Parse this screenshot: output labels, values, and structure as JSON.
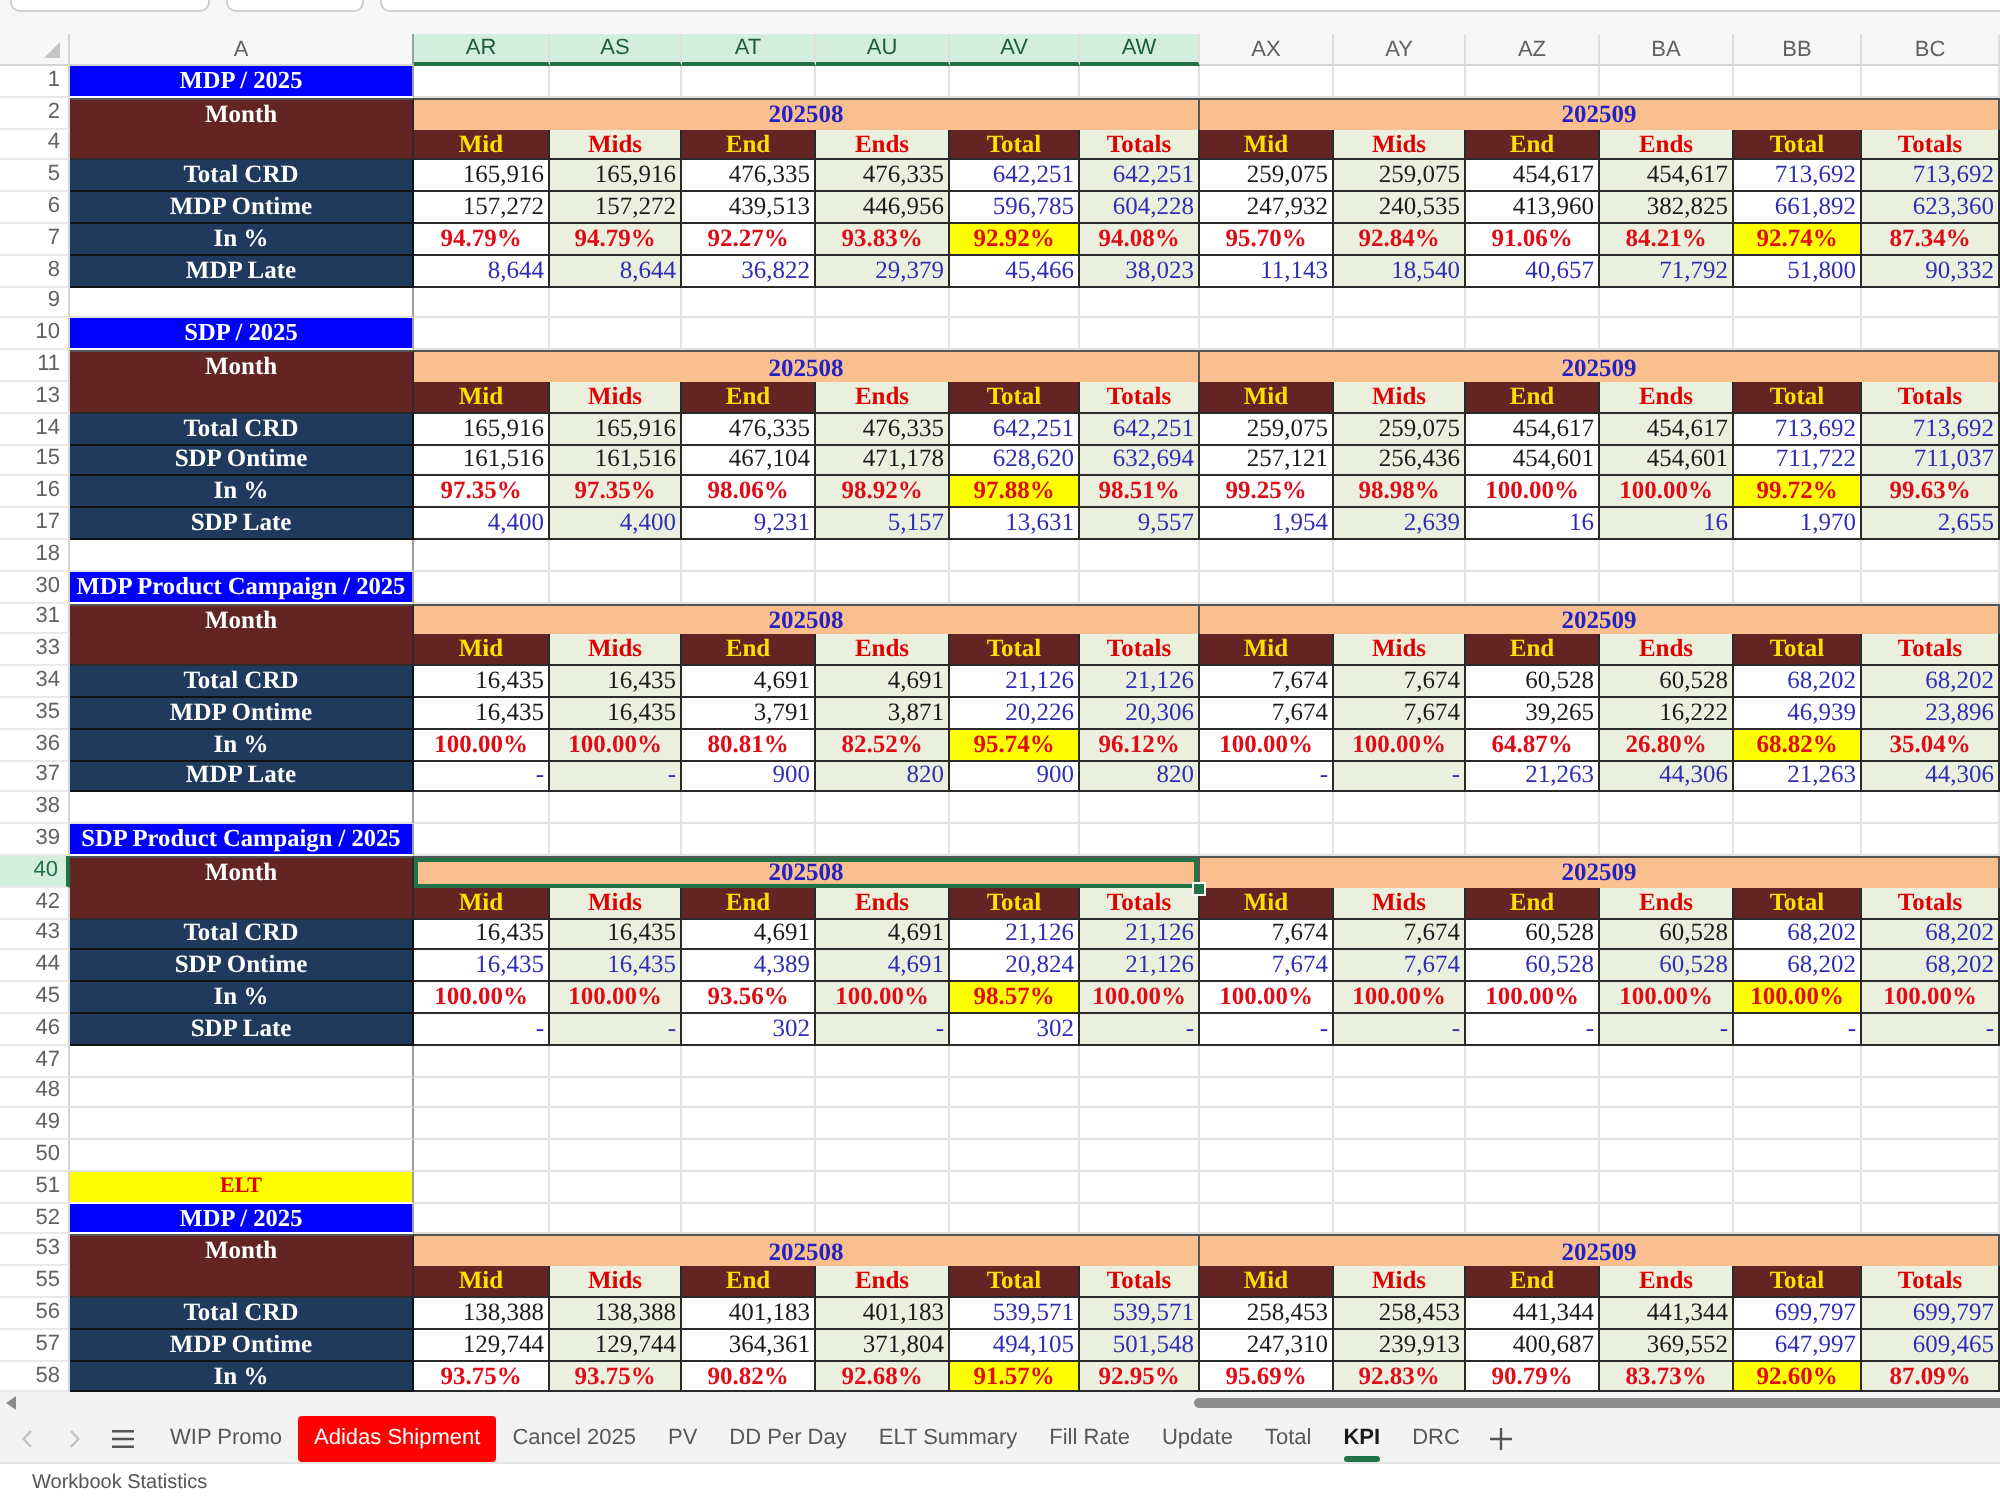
{
  "columns": [
    {
      "label": "A",
      "selected": false
    },
    {
      "label": "AR",
      "selected": true
    },
    {
      "label": "AS",
      "selected": true
    },
    {
      "label": "AT",
      "selected": true
    },
    {
      "label": "AU",
      "selected": true
    },
    {
      "label": "AV",
      "selected": true
    },
    {
      "label": "AW",
      "selected": true
    },
    {
      "label": "AX",
      "selected": false
    },
    {
      "label": "AY",
      "selected": false
    },
    {
      "label": "AZ",
      "selected": false
    },
    {
      "label": "BA",
      "selected": false
    },
    {
      "label": "BB",
      "selected": false
    },
    {
      "label": "BC",
      "selected": false
    }
  ],
  "rows": [
    {
      "number": "1",
      "selected": false,
      "kind": "title",
      "label": "MDP / 2025"
    },
    {
      "number": "2",
      "selected": false,
      "kind": "month",
      "label": "Month",
      "months": [
        "202508",
        "202509"
      ]
    },
    {
      "number": "4",
      "selected": false,
      "kind": "subheader",
      "cells": [
        "Mid",
        "Mids",
        "End",
        "Ends",
        "Total",
        "Totals",
        "Mid",
        "Mids",
        "End",
        "Ends",
        "Total",
        "Totals"
      ]
    },
    {
      "number": "5",
      "selected": false,
      "kind": "count",
      "label": "Total CRD",
      "cells": [
        "165,916",
        "165,916",
        "476,335",
        "476,335",
        "642,251",
        "642,251",
        "259,075",
        "259,075",
        "454,617",
        "454,617",
        "713,692",
        "713,692"
      ]
    },
    {
      "number": "6",
      "selected": false,
      "kind": "count",
      "label": "MDP Ontime",
      "cells": [
        "157,272",
        "157,272",
        "439,513",
        "446,956",
        "596,785",
        "604,228",
        "247,932",
        "240,535",
        "413,960",
        "382,825",
        "661,892",
        "623,360"
      ]
    },
    {
      "number": "7",
      "selected": false,
      "kind": "percent",
      "label": "In %",
      "cells": [
        "94.79%",
        "94.79%",
        "92.27%",
        "93.83%",
        "92.92%",
        "94.08%",
        "95.70%",
        "92.84%",
        "91.06%",
        "84.21%",
        "92.74%",
        "87.34%"
      ]
    },
    {
      "number": "8",
      "selected": false,
      "kind": "late",
      "label": "MDP Late",
      "cells": [
        "8,644",
        "8,644",
        "36,822",
        "29,379",
        "45,466",
        "38,023",
        "11,143",
        "18,540",
        "40,657",
        "71,792",
        "51,800",
        "90,332"
      ]
    },
    {
      "number": "9",
      "selected": false,
      "kind": "blank"
    },
    {
      "number": "10",
      "selected": false,
      "kind": "title",
      "label": "SDP / 2025"
    },
    {
      "number": "11",
      "selected": false,
      "kind": "month",
      "label": "Month",
      "months": [
        "202508",
        "202509"
      ]
    },
    {
      "number": "13",
      "selected": false,
      "kind": "subheader",
      "cells": [
        "Mid",
        "Mids",
        "End",
        "Ends",
        "Total",
        "Totals",
        "Mid",
        "Mids",
        "End",
        "Ends",
        "Total",
        "Totals"
      ]
    },
    {
      "number": "14",
      "selected": false,
      "kind": "count",
      "label": "Total CRD",
      "cells": [
        "165,916",
        "165,916",
        "476,335",
        "476,335",
        "642,251",
        "642,251",
        "259,075",
        "259,075",
        "454,617",
        "454,617",
        "713,692",
        "713,692"
      ]
    },
    {
      "number": "15",
      "selected": false,
      "kind": "count",
      "label": "SDP Ontime",
      "cells": [
        "161,516",
        "161,516",
        "467,104",
        "471,178",
        "628,620",
        "632,694",
        "257,121",
        "256,436",
        "454,601",
        "454,601",
        "711,722",
        "711,037"
      ]
    },
    {
      "number": "16",
      "selected": false,
      "kind": "percent",
      "label": "In %",
      "cells": [
        "97.35%",
        "97.35%",
        "98.06%",
        "98.92%",
        "97.88%",
        "98.51%",
        "99.25%",
        "98.98%",
        "100.00%",
        "100.00%",
        "99.72%",
        "99.63%"
      ]
    },
    {
      "number": "17",
      "selected": false,
      "kind": "late",
      "label": "SDP Late",
      "cells": [
        "4,400",
        "4,400",
        "9,231",
        "5,157",
        "13,631",
        "9,557",
        "1,954",
        "2,639",
        "16",
        "16",
        "1,970",
        "2,655"
      ]
    },
    {
      "number": "18",
      "selected": false,
      "kind": "blank"
    },
    {
      "number": "30",
      "selected": false,
      "kind": "title",
      "label": "MDP Product Campaign / 2025"
    },
    {
      "number": "31",
      "selected": false,
      "kind": "month",
      "label": "Month",
      "months": [
        "202508",
        "202509"
      ]
    },
    {
      "number": "33",
      "selected": false,
      "kind": "subheader",
      "cells": [
        "Mid",
        "Mids",
        "End",
        "Ends",
        "Total",
        "Totals",
        "Mid",
        "Mids",
        "End",
        "Ends",
        "Total",
        "Totals"
      ]
    },
    {
      "number": "34",
      "selected": false,
      "kind": "count",
      "label": "Total CRD",
      "cells": [
        "16,435",
        "16,435",
        "4,691",
        "4,691",
        "21,126",
        "21,126",
        "7,674",
        "7,674",
        "60,528",
        "60,528",
        "68,202",
        "68,202"
      ]
    },
    {
      "number": "35",
      "selected": false,
      "kind": "count",
      "label": "MDP Ontime",
      "cells": [
        "16,435",
        "16,435",
        "3,791",
        "3,871",
        "20,226",
        "20,306",
        "7,674",
        "7,674",
        "39,265",
        "16,222",
        "46,939",
        "23,896"
      ]
    },
    {
      "number": "36",
      "selected": false,
      "kind": "percent",
      "label": "In %",
      "cells": [
        "100.00%",
        "100.00%",
        "80.81%",
        "82.52%",
        "95.74%",
        "96.12%",
        "100.00%",
        "100.00%",
        "64.87%",
        "26.80%",
        "68.82%",
        "35.04%"
      ]
    },
    {
      "number": "37",
      "selected": false,
      "kind": "late",
      "label": "MDP Late",
      "cells": [
        "-",
        "-",
        "900",
        "820",
        "900",
        "820",
        "-",
        "-",
        "21,263",
        "44,306",
        "21,263",
        "44,306"
      ]
    },
    {
      "number": "38",
      "selected": false,
      "kind": "blank"
    },
    {
      "number": "39",
      "selected": false,
      "kind": "title",
      "label": "SDP Product Campaign / 2025"
    },
    {
      "number": "40",
      "selected": true,
      "kind": "month",
      "label": "Month",
      "months": [
        "202508",
        "202509"
      ]
    },
    {
      "number": "42",
      "selected": false,
      "kind": "subheader",
      "cells": [
        "Mid",
        "Mids",
        "End",
        "Ends",
        "Total",
        "Totals",
        "Mid",
        "Mids",
        "End",
        "Ends",
        "Total",
        "Totals"
      ]
    },
    {
      "number": "43",
      "selected": false,
      "kind": "count",
      "label": "Total CRD",
      "cells": [
        "16,435",
        "16,435",
        "4,691",
        "4,691",
        "21,126",
        "21,126",
        "7,674",
        "7,674",
        "60,528",
        "60,528",
        "68,202",
        "68,202"
      ]
    },
    {
      "number": "44",
      "selected": false,
      "kind": "count_linked",
      "label": "SDP Ontime",
      "cells": [
        "16,435",
        "16,435",
        "4,389",
        "4,691",
        "20,824",
        "21,126",
        "7,674",
        "7,674",
        "60,528",
        "60,528",
        "68,202",
        "68,202"
      ]
    },
    {
      "number": "45",
      "selected": false,
      "kind": "percent",
      "label": "In %",
      "cells": [
        "100.00%",
        "100.00%",
        "93.56%",
        "100.00%",
        "98.57%",
        "100.00%",
        "100.00%",
        "100.00%",
        "100.00%",
        "100.00%",
        "100.00%",
        "100.00%"
      ]
    },
    {
      "number": "46",
      "selected": false,
      "kind": "late",
      "label": "SDP Late",
      "cells": [
        "-",
        "-",
        "302",
        "-",
        "302",
        "-",
        "-",
        "-",
        "-",
        "-",
        "-",
        "-"
      ]
    },
    {
      "number": "47",
      "selected": false,
      "kind": "blank"
    },
    {
      "number": "48",
      "selected": false,
      "kind": "blank"
    },
    {
      "number": "49",
      "selected": false,
      "kind": "blank"
    },
    {
      "number": "50",
      "selected": false,
      "kind": "blank"
    },
    {
      "number": "51",
      "selected": false,
      "kind": "banner",
      "label": "ELT"
    },
    {
      "number": "52",
      "selected": false,
      "kind": "title",
      "label": "MDP / 2025"
    },
    {
      "number": "53",
      "selected": false,
      "kind": "month",
      "label": "Month",
      "months": [
        "202508",
        "202509"
      ]
    },
    {
      "number": "55",
      "selected": false,
      "kind": "subheader",
      "cells": [
        "Mid",
        "Mids",
        "End",
        "Ends",
        "Total",
        "Totals",
        "Mid",
        "Mids",
        "End",
        "Ends",
        "Total",
        "Totals"
      ]
    },
    {
      "number": "56",
      "selected": false,
      "kind": "count",
      "label": "Total CRD",
      "cells": [
        "138,388",
        "138,388",
        "401,183",
        "401,183",
        "539,571",
        "539,571",
        "258,453",
        "258,453",
        "441,344",
        "441,344",
        "699,797",
        "699,797"
      ]
    },
    {
      "number": "57",
      "selected": false,
      "kind": "count",
      "label": "MDP Ontime",
      "cells": [
        "129,744",
        "129,744",
        "364,361",
        "371,804",
        "494,105",
        "501,548",
        "247,310",
        "239,913",
        "400,687",
        "369,552",
        "647,997",
        "609,465"
      ]
    },
    {
      "number": "58",
      "selected": false,
      "kind": "percent",
      "label": "In %",
      "cells": [
        "93.75%",
        "93.75%",
        "90.82%",
        "92.68%",
        "91.57%",
        "92.95%",
        "95.69%",
        "92.83%",
        "90.79%",
        "83.73%",
        "92.60%",
        "87.09%"
      ]
    }
  ],
  "tabs": [
    {
      "label": "WIP Promo",
      "selected": false
    },
    {
      "label": "Adidas Shipment",
      "selected": false,
      "color": "#ff0000"
    },
    {
      "label": "Cancel 2025",
      "selected": false
    },
    {
      "label": "PV",
      "selected": false
    },
    {
      "label": "DD Per Day",
      "selected": false
    },
    {
      "label": "ELT Summary",
      "selected": false
    },
    {
      "label": "Fill Rate",
      "selected": false
    },
    {
      "label": "Update",
      "selected": false
    },
    {
      "label": "Total",
      "selected": false
    },
    {
      "label": "KPI",
      "selected": true
    },
    {
      "label": "DRC",
      "selected": false
    }
  ],
  "status_bar": {
    "text": "Workbook Statistics"
  }
}
